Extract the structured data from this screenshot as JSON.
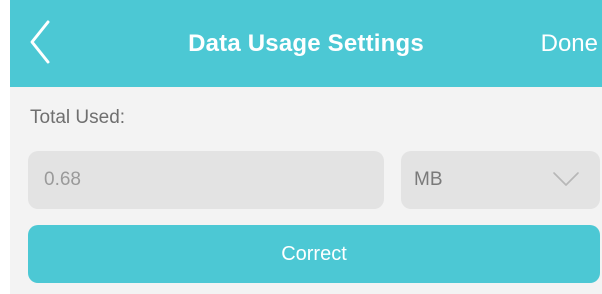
{
  "header": {
    "title": "Data Usage Settings",
    "done_label": "Done",
    "back_icon": "chevron-left-icon"
  },
  "usage": {
    "label": "Total Used:",
    "value": "0.68"
  },
  "unit": {
    "selected": "MB",
    "dropdown_icon": "chevron-down-icon"
  },
  "actions": {
    "correct_label": "Correct"
  },
  "colors": {
    "accent": "#4cc8d4",
    "content_bg": "#f3f3f3",
    "field_bg": "#e3e3e3",
    "label_text": "#6f6f6f",
    "value_text": "#9a9a9a"
  }
}
